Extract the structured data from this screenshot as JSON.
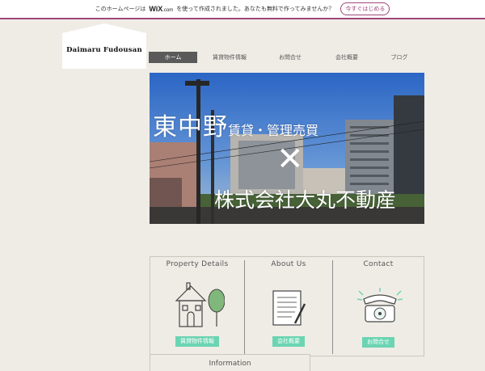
{
  "wix_banner": {
    "prefix": "このホームページは",
    "brand": "WiX",
    "brand_suffix": ".com",
    "suffix": "を使って作成されました。あなたも無料で作ってみませんか？",
    "cta": "今すぐはじめる"
  },
  "logo": {
    "text": "Daimaru Fudousan"
  },
  "nav": {
    "items": [
      {
        "label": "ホーム",
        "active": true
      },
      {
        "label": "賃貸物件情報",
        "active": false
      },
      {
        "label": "お問合せ",
        "active": false
      },
      {
        "label": "会社概要",
        "active": false
      },
      {
        "label": "ブログ",
        "active": false
      }
    ]
  },
  "hero": {
    "line1_big": "東中野",
    "line1_small": "賃貸・管理売買",
    "cross": "✕",
    "line2": "株式会社大丸不動産"
  },
  "sections": [
    {
      "title": "Property Details",
      "button": "賃貸物件情報",
      "icon": "house-tree-icon"
    },
    {
      "title": "About Us",
      "button": "会社概要",
      "icon": "notepad-pen-icon"
    },
    {
      "title": "Contact",
      "button": "お問合せ",
      "icon": "rotary-phone-icon"
    }
  ],
  "info": {
    "title": "Information"
  },
  "colors": {
    "accent": "#a0467b",
    "button": "#6cd4b2",
    "nav_active": "#5a5a5a"
  }
}
